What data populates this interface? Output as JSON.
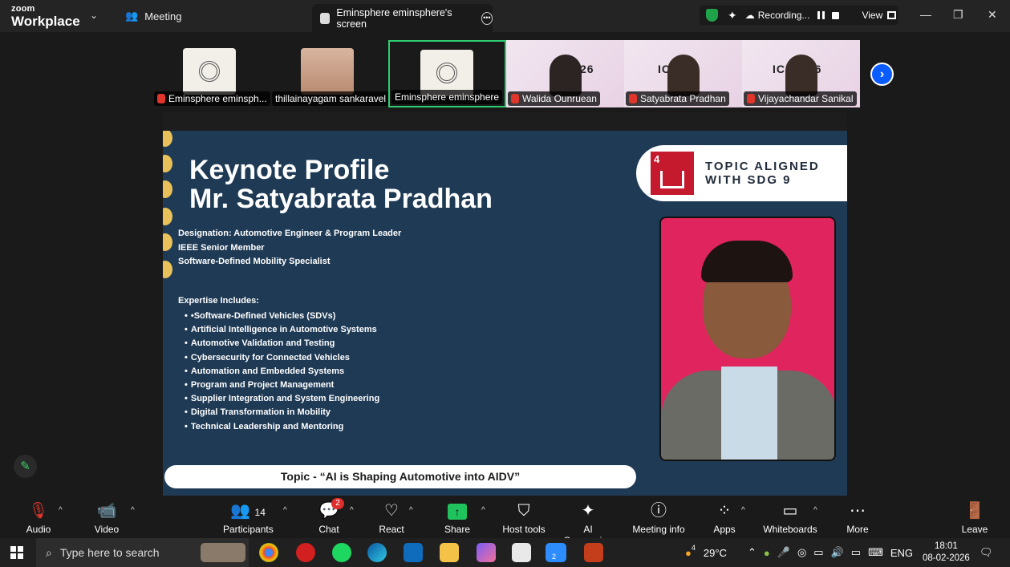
{
  "titlebar": {
    "brand_top": "zoom",
    "brand_bottom": "Workplace",
    "meeting_tab": "Meeting",
    "share_tab": "Eminsphere eminsphere's screen",
    "recording_label": "Recording...",
    "view_label": "View"
  },
  "filmstrip": [
    {
      "name": "Eminsphere eminsph...",
      "muted": true
    },
    {
      "name": "thillainayagam sankaravel",
      "muted": false
    },
    {
      "name": "Eminsphere eminsphere",
      "muted": false
    },
    {
      "name": "Walida Ounruean",
      "muted": true,
      "slide_text": "S-26"
    },
    {
      "name": "Satyabrata Pradhan",
      "muted": true,
      "slide_text": "IC  26"
    },
    {
      "name": "Vijayachandar Sanikal",
      "muted": true,
      "slide_text": "ICME  26"
    }
  ],
  "slide": {
    "title_line1": "Keynote Profile",
    "title_line2": "Mr. Satyabrata Pradhan",
    "designation": [
      "Designation: Automotive Engineer & Program Leader",
      " IEEE Senior Member",
      " Software-Defined Mobility Specialist"
    ],
    "expertise_heading": "Expertise Includes:",
    "expertise": [
      "•Software-Defined Vehicles (SDVs)",
      "Artificial Intelligence in Automotive Systems",
      "Automotive Validation and Testing",
      "Cybersecurity for Connected Vehicles",
      "Automation and Embedded Systems",
      "Program and Project Management",
      "Supplier Integration and System Engineering",
      "Digital Transformation in Mobility",
      "Technical Leadership and Mentoring"
    ],
    "sdg_number": "4",
    "sdg_line1": "TOPIC ALIGNED",
    "sdg_line2": "WITH SDG 9",
    "topic": "Topic - “AI is Shaping Automotive into AIDV”"
  },
  "toolbar": {
    "audio": "Audio",
    "video": "Video",
    "participants": "Participants",
    "participants_count": "14",
    "chat": "Chat",
    "chat_badge": "2",
    "react": "React",
    "share": "Share",
    "host_tools": "Host tools",
    "ai_companion": "AI Companion",
    "meeting_info": "Meeting info",
    "apps": "Apps",
    "whiteboards": "Whiteboards",
    "more": "More",
    "leave": "Leave"
  },
  "taskbar": {
    "search_placeholder": "Type here to search",
    "weather": "29°C",
    "weather_badge": "4",
    "lang": "ENG",
    "time": "18:01",
    "date": "08-02-2026",
    "zoom_badge": "2"
  },
  "colors": {
    "slide_bg": "#1f3a55",
    "active_border": "#2ecc71",
    "share_green": "#1fc25c",
    "record_shield": "#1fa34a",
    "sdg_red": "#c5192d",
    "photo_bg": "#e0245e"
  }
}
